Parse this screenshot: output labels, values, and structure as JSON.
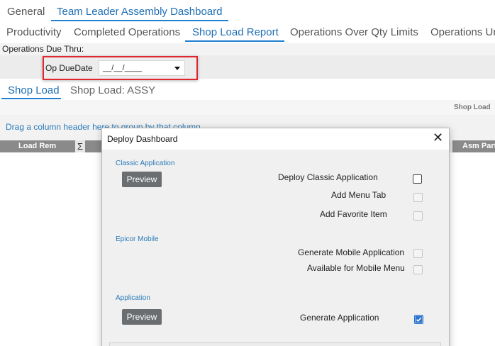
{
  "top_tabs": [
    {
      "label": "General"
    },
    {
      "label": "Team Leader Assembly Dashboard"
    }
  ],
  "sub_tabs": [
    {
      "label": "Productivity"
    },
    {
      "label": "Completed Operations"
    },
    {
      "label": "Shop Load Report"
    },
    {
      "label": "Operations Over Qty Limits"
    },
    {
      "label": "Operations Ur"
    }
  ],
  "filter": {
    "section_label": "Operations Due Thru:",
    "op_due_date_label": "Op DueDate",
    "op_due_date_value": "__/__/____"
  },
  "grid_tabs": [
    {
      "label": "Shop Load"
    },
    {
      "label": "Shop Load: ASSY"
    }
  ],
  "grid": {
    "caption": "Shop Load",
    "group_hint": "Drag a column header here to group by that column",
    "columns": [
      "Load Rem",
      "Asm Part"
    ]
  },
  "dialog": {
    "title": "Deploy Dashboard",
    "sections": {
      "classic": {
        "label": "Classic Application",
        "preview_label": "Preview",
        "options": [
          {
            "label": "Deploy Classic Application",
            "checked": false,
            "enabled": true
          },
          {
            "label": "Add Menu Tab",
            "checked": false,
            "enabled": false
          },
          {
            "label": "Add Favorite Item",
            "checked": false,
            "enabled": false
          }
        ]
      },
      "mobile": {
        "label": "Epicor Mobile",
        "options": [
          {
            "label": "Generate Mobile Application",
            "checked": false,
            "enabled": false
          },
          {
            "label": "Available for Mobile Menu",
            "checked": false,
            "enabled": false
          }
        ]
      },
      "application": {
        "label": "Application",
        "preview_label": "Preview",
        "options": [
          {
            "label": "Generate Application",
            "checked": true,
            "enabled": true
          }
        ]
      }
    }
  },
  "colors": {
    "accent": "#1f6fb5",
    "highlight_border": "#e0262e",
    "grid_header": "#8a8a8a",
    "preview_button": "#6b6e70"
  }
}
